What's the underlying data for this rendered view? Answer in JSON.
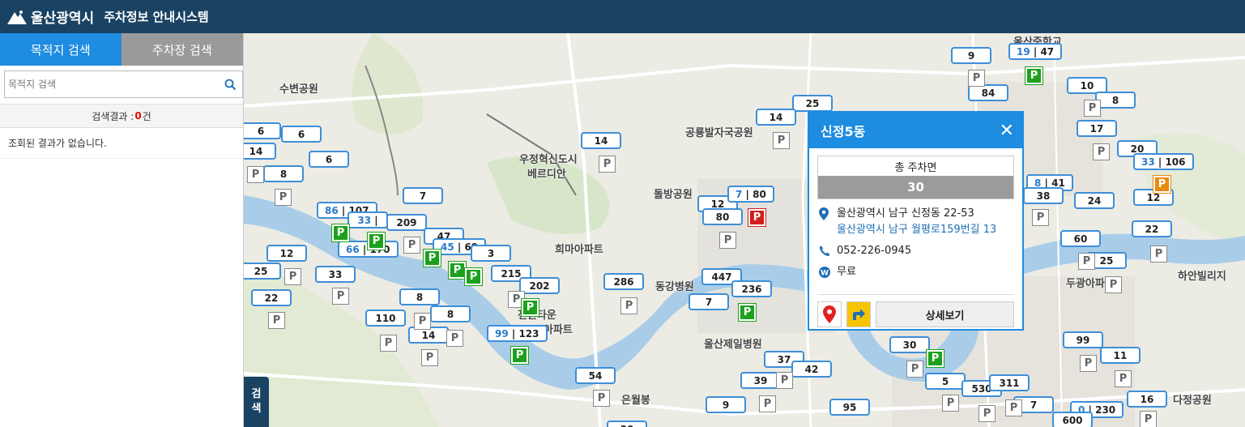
{
  "header": {
    "logo_text": "울산광역시",
    "system_title": "주차정보 안내시스템"
  },
  "sidebar": {
    "tabs": [
      {
        "label": "목적지 검색"
      },
      {
        "label": "주차장 검색"
      }
    ],
    "search_placeholder": "목적지 검색",
    "result_prefix": "검색결과 : ",
    "result_count": "0",
    "result_suffix": "건",
    "no_result_text": "조회된 결과가 없습니다.",
    "toggle_label_1": "검",
    "toggle_label_2": "색"
  },
  "map": {
    "place_labels": [
      "수변공원",
      "공룡발자국공원",
      "돌방공원",
      "희마아파트",
      "동강병원",
      "전원타운",
      "아파트",
      "울산제일병원",
      "은월봉",
      "우정혁신도시",
      "베르디안",
      "두광아파",
      "하안빌리지",
      "다정공원",
      "울산중학교"
    ],
    "bubbles": [
      {
        "v1": "9"
      },
      {
        "v1": "19",
        "v2": "47"
      },
      {
        "v1": "84"
      },
      {
        "v1": "10"
      },
      {
        "v1": "8"
      },
      {
        "v1": "17"
      },
      {
        "v1": "20"
      },
      {
        "v1": "33",
        "v2": "106"
      },
      {
        "v1": "25"
      },
      {
        "v1": "14"
      },
      {
        "v1": "14"
      },
      {
        "v1": "6"
      },
      {
        "v1": "6"
      },
      {
        "v1": "14"
      },
      {
        "v1": "8"
      },
      {
        "v1": "6"
      },
      {
        "v1": "7"
      },
      {
        "v1": "86",
        "v2": "107"
      },
      {
        "v1": "33"
      },
      {
        "v1": "209"
      },
      {
        "v1": "47"
      },
      {
        "v1": "66",
        "v2": "170"
      },
      {
        "v1": "45",
        "v2": "69"
      },
      {
        "v1": "3"
      },
      {
        "v1": "12"
      },
      {
        "v1": "25"
      },
      {
        "v1": "33"
      },
      {
        "v1": "215"
      },
      {
        "v1": "202"
      },
      {
        "v1": "286"
      },
      {
        "v1": "447"
      },
      {
        "v1": "236"
      },
      {
        "v1": "7"
      },
      {
        "v1": "22"
      },
      {
        "v1": "8"
      },
      {
        "v1": "110"
      },
      {
        "v1": "8"
      },
      {
        "v1": "14"
      },
      {
        "v1": "99",
        "v2": "123"
      },
      {
        "v1": "12"
      },
      {
        "v1": "7",
        "v2": "80"
      },
      {
        "v1": "80"
      },
      {
        "v1": "8",
        "v2": "41"
      },
      {
        "v1": "38"
      },
      {
        "v1": "24"
      },
      {
        "v1": "12"
      },
      {
        "v1": "22"
      },
      {
        "v1": "60"
      },
      {
        "v1": "25"
      },
      {
        "v1": "30"
      },
      {
        "v1": "99"
      },
      {
        "v1": "11"
      },
      {
        "v1": "37"
      },
      {
        "v1": "42"
      },
      {
        "v1": "39"
      },
      {
        "v1": "54"
      },
      {
        "v1": "9"
      },
      {
        "v1": "95"
      },
      {
        "v1": "5"
      },
      {
        "v1": "530"
      },
      {
        "v1": "7"
      },
      {
        "v1": "311"
      },
      {
        "v1": "16"
      },
      {
        "v1": "0",
        "v2": "230"
      },
      {
        "v1": "600"
      },
      {
        "v1": "30"
      }
    ]
  },
  "popup": {
    "title": "신정5동",
    "total_label": "총 주차면",
    "total_value": "30",
    "address": "울산광역시 남구 신정동 22-53",
    "road_address": "울산광역시 남구 월평로159번길 13",
    "phone": "052-226-0945",
    "fee": "무료",
    "detail_button": "상세보기"
  },
  "colors": {
    "header_bg": "#1a4263",
    "accent": "#1e8ce0",
    "tab_inactive": "#9a9a9a",
    "count_red": "#e00000"
  }
}
